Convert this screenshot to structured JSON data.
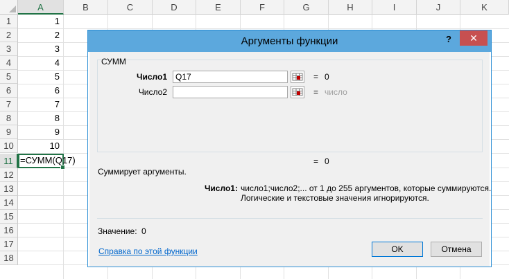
{
  "sheet": {
    "columns": [
      "A",
      "B",
      "C",
      "D",
      "E",
      "F",
      "G",
      "H",
      "I",
      "J",
      "K"
    ],
    "rows": [
      "1",
      "2",
      "3",
      "4",
      "5",
      "6",
      "7",
      "8",
      "9",
      "10",
      "11",
      "12",
      "13",
      "14",
      "15",
      "16",
      "17",
      "18"
    ],
    "colA_values": [
      "1",
      "2",
      "3",
      "4",
      "5",
      "6",
      "7",
      "8",
      "9",
      "10"
    ],
    "active_cell_formula": "=СУММ(Q17)",
    "accent": "#217346"
  },
  "dialog": {
    "title": "Аргументы функции",
    "help_label": "?",
    "close_label": "✕",
    "function_name": "СУММ",
    "args": [
      {
        "label": "Число1",
        "value": "Q17",
        "result": "0"
      },
      {
        "label": "Число2",
        "value": "",
        "result": "число"
      }
    ],
    "eq_sign": "=",
    "formula_result": "0",
    "description": "Суммирует аргументы.",
    "arg_help_label": "Число1:",
    "arg_help_line1": "число1;число2;... от 1 до 255 аргументов, которые суммируются.",
    "arg_help_line2": "Логические и текстовые значения игнорируются.",
    "value_label": "Значение:",
    "value": "0",
    "help_link": "Справка по этой функции",
    "ok_label": "OK",
    "cancel_label": "Отмена",
    "titlebar_color": "#5ca8dd",
    "close_color": "#c75050"
  }
}
